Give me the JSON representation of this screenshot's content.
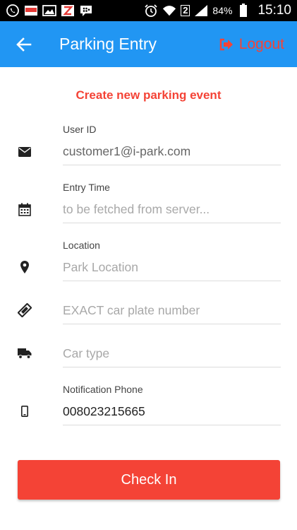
{
  "status_bar": {
    "time": "15:10",
    "battery": "84%",
    "sim": "2",
    "icons": [
      "whatsapp-icon",
      "app-notification-icon",
      "gallery-icon",
      "zenith-icon",
      "bbm-icon",
      "alarm-icon",
      "wifi-icon",
      "signal-icon",
      "battery-icon"
    ]
  },
  "app_bar": {
    "title": "Parking Entry",
    "logout_label": "Logout",
    "background": "#2196f3",
    "accent": "#f44336"
  },
  "form": {
    "heading": "Create new parking event",
    "user_id": {
      "label": "User ID",
      "value": "customer1@i-park.com",
      "icon": "envelope-icon"
    },
    "entry_time": {
      "label": "Entry Time",
      "placeholder": "to be fetched from server...",
      "icon": "calendar-icon"
    },
    "location": {
      "label": "Location",
      "placeholder": "Park Location",
      "icon": "map-marker-icon"
    },
    "plate": {
      "placeholder": "EXACT car plate number",
      "icon": "ticket-icon"
    },
    "car_type": {
      "placeholder": "Car type",
      "icon": "truck-icon"
    },
    "phone": {
      "label": "Notification Phone",
      "value": "008023215665",
      "icon": "mobile-phone-icon"
    }
  },
  "submit": {
    "label": "Check In"
  }
}
